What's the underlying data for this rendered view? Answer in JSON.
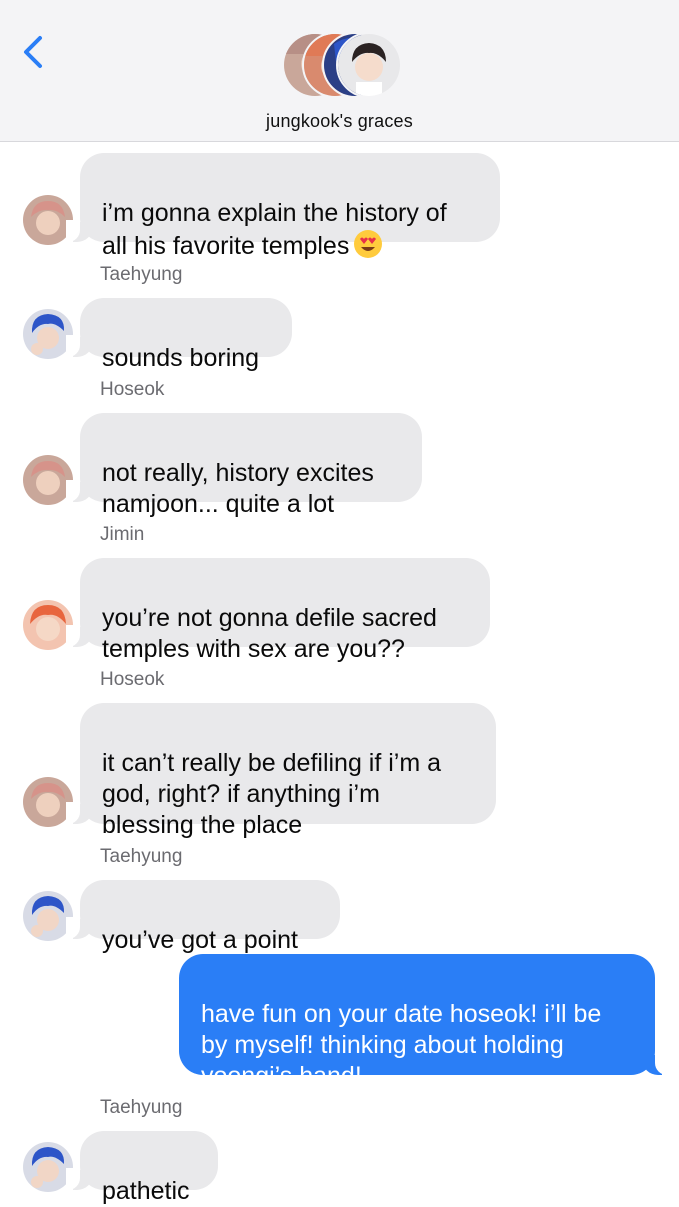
{
  "header": {
    "group_name": "jungkook's graces",
    "back_icon": "chevron-left-icon",
    "accent": "#2a7ef6"
  },
  "messages": [
    {
      "sender": "",
      "text": "i’m gonna explain the history of\nall his favorite temples",
      "emoji": "heart-eyes-emoji"
    },
    {
      "sender": "Taehyung",
      "text": "sounds boring"
    },
    {
      "sender": "Hoseok",
      "text": "not really, history excites\nnamjoon... quite a lot"
    },
    {
      "sender": "Jimin",
      "text": "you’re not gonna defile sacred\ntemples with sex are you??"
    },
    {
      "sender": "Hoseok",
      "text": "it can’t really be defiling if i’m a\ngod, right? if anything i’m\nblessing the place"
    },
    {
      "sender": "Taehyung",
      "text": "you’ve got a point"
    },
    {
      "sender": "me",
      "text": "have fun on your date hoseok! i’ll be\nby myself! thinking about holding\nyoongi’s hand!"
    },
    {
      "sender": "Taehyung",
      "text": "pathetic"
    }
  ],
  "colors": {
    "incoming_bubble": "#e9e9eb",
    "outgoing_bubble": "#2a7ef6",
    "sender_label": "#6b6b70"
  }
}
